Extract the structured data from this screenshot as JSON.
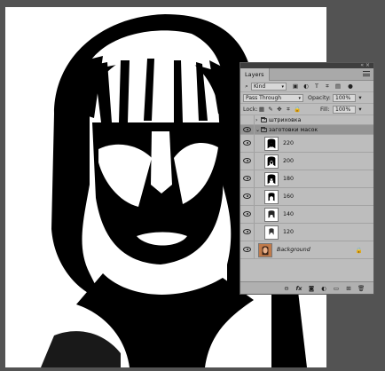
{
  "panel": {
    "tab_label": "Layers",
    "top_controls": "« ×",
    "filter_kind": "Kind",
    "blend_mode": "Pass Through",
    "opacity_label": "Opacity:",
    "opacity_value": "100%",
    "lock_label": "Lock:",
    "fill_label": "Fill:",
    "fill_value": "100%"
  },
  "layers": [
    {
      "name": "штриховка",
      "type": "group",
      "expanded": false,
      "visible": false
    },
    {
      "name": "заготовки масок",
      "type": "group",
      "expanded": true,
      "visible": true,
      "selected": true
    },
    {
      "name": "220",
      "type": "layer",
      "visible": true
    },
    {
      "name": "200",
      "type": "layer",
      "visible": true
    },
    {
      "name": "180",
      "type": "layer",
      "visible": true
    },
    {
      "name": "160",
      "type": "layer",
      "visible": true
    },
    {
      "name": "140",
      "type": "layer",
      "visible": true
    },
    {
      "name": "120",
      "type": "layer",
      "visible": true
    },
    {
      "name": "Background",
      "type": "background",
      "visible": true,
      "locked": true
    }
  ],
  "icons": {
    "filter": "search-icon",
    "fx": "fx"
  },
  "colors": {
    "workspace": "#535353",
    "panel": "#bdbdbd",
    "selected_row": "#949494"
  }
}
